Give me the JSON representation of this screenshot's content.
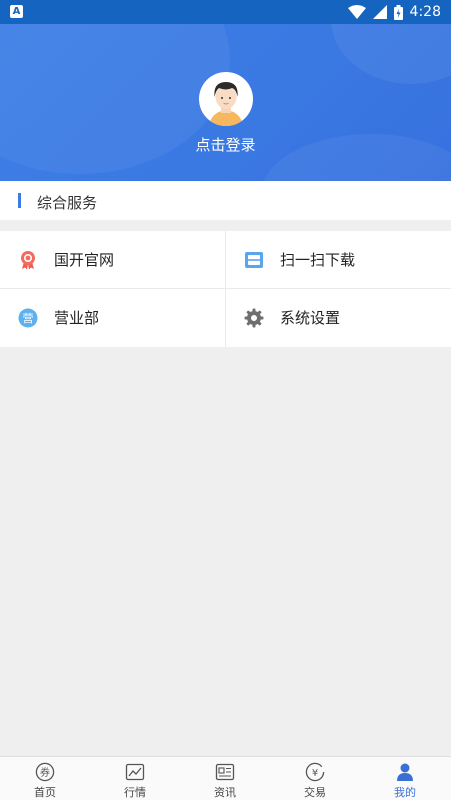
{
  "status_bar": {
    "time": "4:28",
    "left_icon_letter": "A"
  },
  "header": {
    "login_text": "点击登录"
  },
  "section": {
    "title": "综合服务"
  },
  "services": [
    {
      "label": "国开官网",
      "icon": "award-ribbon-icon"
    },
    {
      "label": "扫一扫下载",
      "icon": "scan-icon"
    },
    {
      "label": "营业部",
      "icon": "branch-icon",
      "icon_text": "营"
    },
    {
      "label": "系统设置",
      "icon": "gear-icon"
    }
  ],
  "bottom_nav": [
    {
      "label": "首页",
      "icon": "home-coupon-icon",
      "icon_text": "券"
    },
    {
      "label": "行情",
      "icon": "chart-icon"
    },
    {
      "label": "资讯",
      "icon": "news-icon"
    },
    {
      "label": "交易",
      "icon": "trade-yen-icon",
      "icon_text": "¥"
    },
    {
      "label": "我的",
      "icon": "user-icon",
      "active": true
    }
  ],
  "colors": {
    "primary": "#3a7be4",
    "status_bar": "#1565c0",
    "nav_active": "#3a70d4"
  }
}
